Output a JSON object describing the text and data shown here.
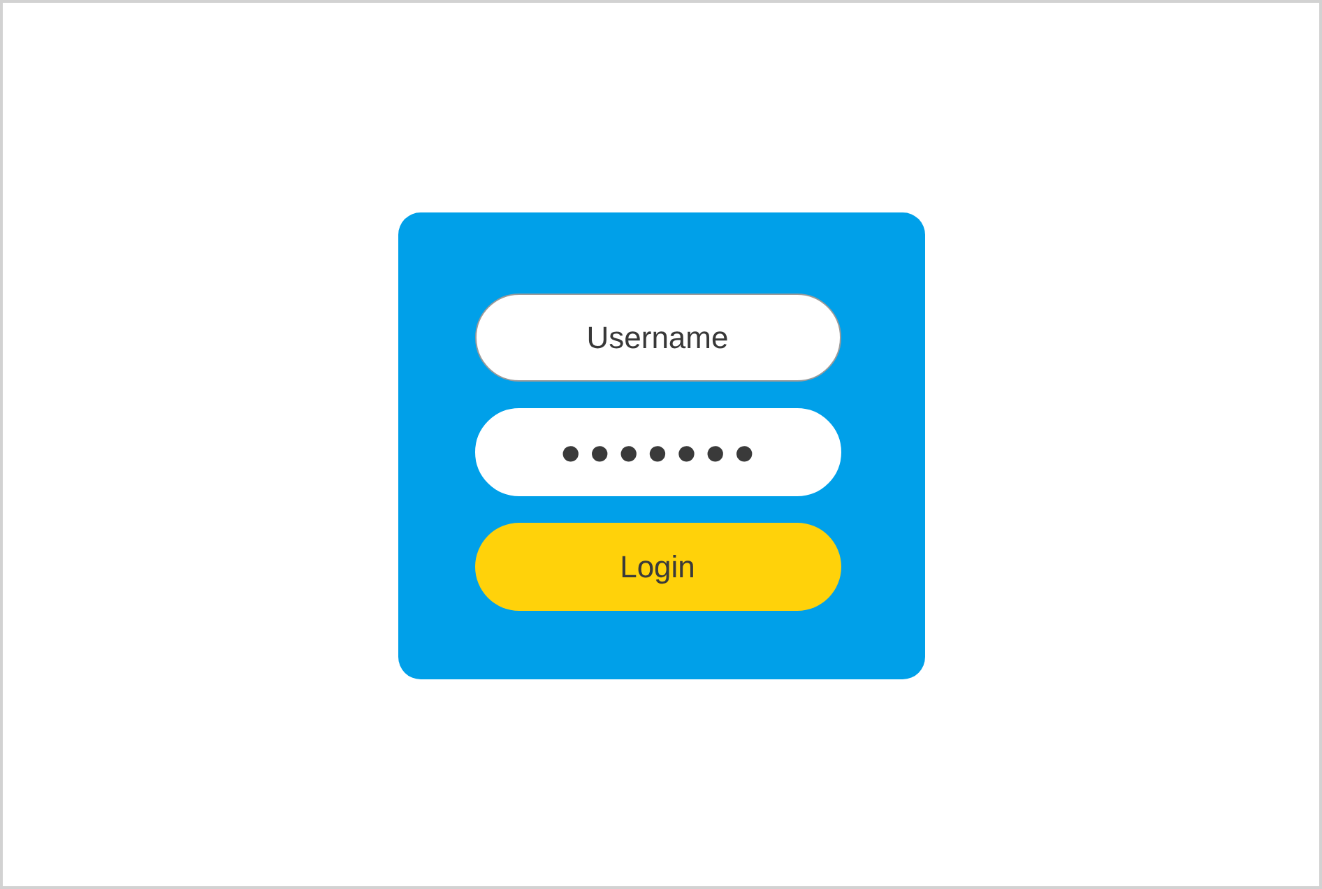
{
  "login_form": {
    "fields": [
      {
        "kind": "text",
        "placeholder": "Username",
        "focused": true
      },
      {
        "kind": "password",
        "value": "●●●●●●●",
        "focused": false
      }
    ],
    "submit_button": {
      "label": "Login"
    }
  }
}
